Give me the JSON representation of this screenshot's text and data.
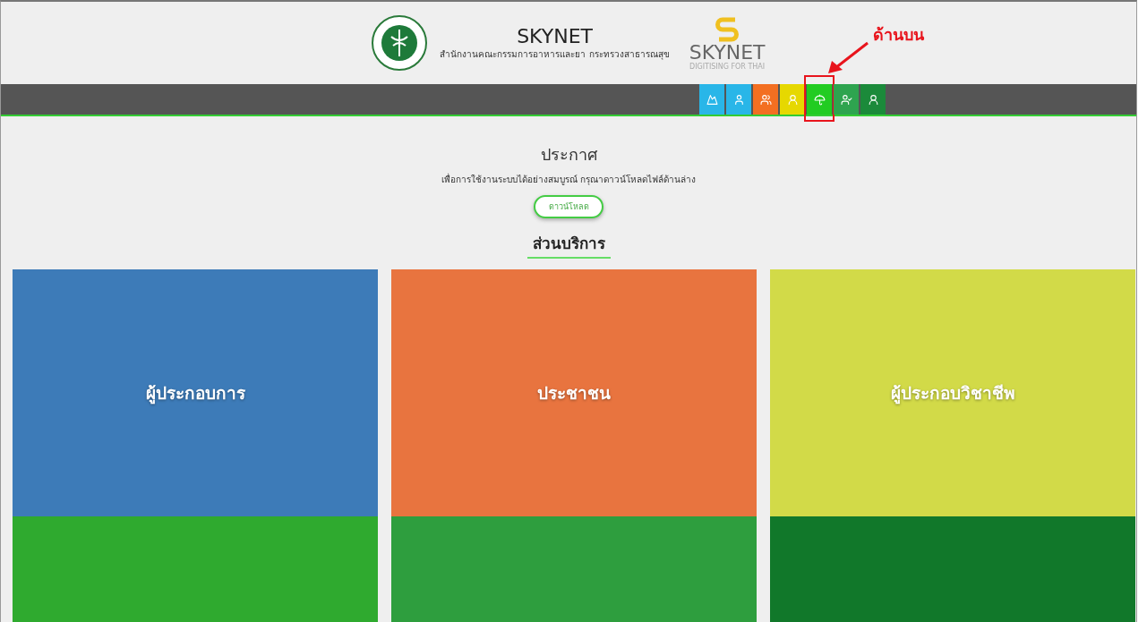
{
  "header": {
    "title": "SKYNET",
    "subtitle": "สำนักงานคณะกรรมการอาหารและยา กระทรวงสาธารณสุข",
    "logo_text": "SKYNET",
    "logo_tagline": "DIGITISING FOR THAI"
  },
  "nav_tiles": [
    {
      "color": "#29b6e8"
    },
    {
      "color": "#29b6e8"
    },
    {
      "color": "#f36f21"
    },
    {
      "color": "#e6d800"
    },
    {
      "color": "#22cc22",
      "highlighted": true
    },
    {
      "color": "#2ea44f"
    },
    {
      "color": "#1b8a3a"
    }
  ],
  "annotation": {
    "label": "ด้านบน"
  },
  "notice": {
    "title": "ประกาศ",
    "text": "เพื่อการใช้งานระบบได้อย่างสมบูรณ์ กรุณาดาวน์โหลดไฟล์ด้านล่าง",
    "button": "ดาวน์โหลด"
  },
  "services": {
    "heading": "ส่วนบริการ",
    "cards": [
      {
        "label": "ผู้ประกอบการ",
        "color": "#3d7bb8"
      },
      {
        "label": "ประชาชน",
        "color": "#e8743f"
      },
      {
        "label": "ผู้ประกอบวิชาชีพ",
        "color": "#d2da48"
      },
      {
        "color": "#2faa2f"
      },
      {
        "color": "#2e9e3e"
      },
      {
        "color": "#11782a"
      }
    ]
  }
}
